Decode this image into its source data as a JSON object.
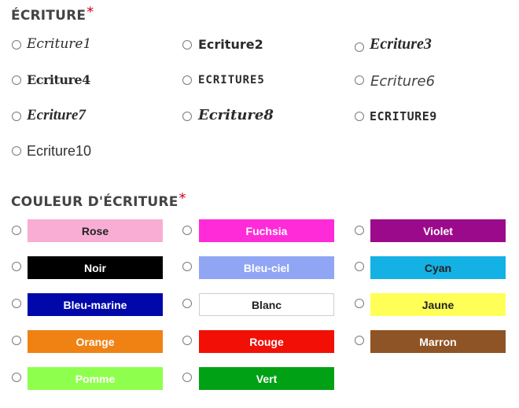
{
  "font_section": {
    "title": "ÉCRITURE",
    "required_mark": "*",
    "options": [
      {
        "label": "Ecriture1"
      },
      {
        "label": "Ecriture2"
      },
      {
        "label": "Ecriture3"
      },
      {
        "label": "Ecriture4"
      },
      {
        "label": "ECRITURE5"
      },
      {
        "label": "Ecriture6"
      },
      {
        "label": "Ecriture7"
      },
      {
        "label": "Ecriture8"
      },
      {
        "label": "ECRITURE9"
      },
      {
        "label": "Ecriture10"
      }
    ]
  },
  "color_section": {
    "title": "COULEUR D'ÉCRITURE",
    "required_mark": "*",
    "options": [
      {
        "label": "Rose",
        "bg": "#f9add5",
        "fg": "#222222"
      },
      {
        "label": "Fuchsia",
        "bg": "#ff2bd9",
        "fg": "#ffffff"
      },
      {
        "label": "Violet",
        "bg": "#9c0a8c",
        "fg": "#ffffff"
      },
      {
        "label": "Noir",
        "bg": "#000000",
        "fg": "#ffffff"
      },
      {
        "label": "Bleu-ciel",
        "bg": "#90a6f4",
        "fg": "#ffffff"
      },
      {
        "label": "Cyan",
        "bg": "#14b1e5",
        "fg": "#222222"
      },
      {
        "label": "Bleu-marine",
        "bg": "#0008aa",
        "fg": "#ffffff"
      },
      {
        "label": "Blanc",
        "bg": "#ffffff",
        "fg": "#222222"
      },
      {
        "label": "Jaune",
        "bg": "#ffff57",
        "fg": "#222222"
      },
      {
        "label": "Orange",
        "bg": "#f08214",
        "fg": "#ffffff"
      },
      {
        "label": "Rouge",
        "bg": "#f20f06",
        "fg": "#ffffff"
      },
      {
        "label": "Marron",
        "bg": "#8f5425",
        "fg": "#ffffff"
      },
      {
        "label": "Pomme",
        "bg": "#8fff4d",
        "fg": "#ffffff"
      },
      {
        "label": "Vert",
        "bg": "#00a115",
        "fg": "#ffffff"
      }
    ]
  }
}
